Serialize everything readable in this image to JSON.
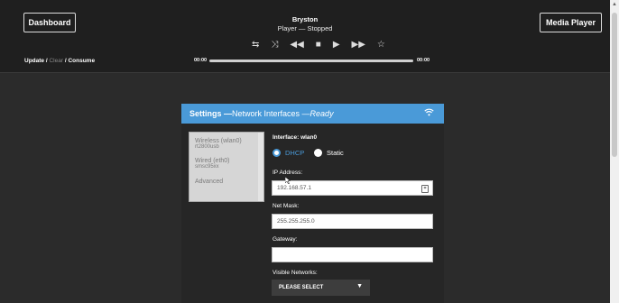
{
  "header": {
    "dashboard_label": "Dashboard",
    "media_player_label": "Media Player",
    "device_name": "Bryston",
    "status": "Player — Stopped"
  },
  "controls": {
    "repeat": "⇆",
    "shuffle": "⤨",
    "rewind": "◀◀",
    "stop": "■",
    "play": "▶",
    "forward": "▶▶",
    "favorite": "☆"
  },
  "breadcrumb": {
    "update": "Update",
    "sep1": "/",
    "clear": "Clear",
    "sep2": "/",
    "consume": "Consume"
  },
  "timebar": {
    "elapsed": "00:00",
    "total": "00:00"
  },
  "panel": {
    "title_bold": "Settings —",
    "title_mid": " Network Interfaces — ",
    "title_italic": "Ready",
    "interfaces": [
      {
        "name": "Wireless (wlan0)",
        "chip": "rt2800usb"
      },
      {
        "name": "Wired (eth0)",
        "chip": "smsc95xx"
      },
      {
        "name": "Advanced"
      }
    ],
    "interface_label": "Interface: wlan0",
    "dhcp_label": "DHCP",
    "static_label": "Static",
    "ip_label": "IP Address:",
    "ip_value": "192.168.57.1",
    "mask_label": "Net Mask:",
    "mask_value": "255.255.255.0",
    "gateway_label": "Gateway:",
    "gateway_value": "",
    "networks_label": "Visible Networks:",
    "networks_select": "PLEASE SELECT"
  },
  "colors": {
    "accent": "#4a9ad8",
    "background": "#2b2b2b",
    "topbar": "#1f1f1f"
  }
}
